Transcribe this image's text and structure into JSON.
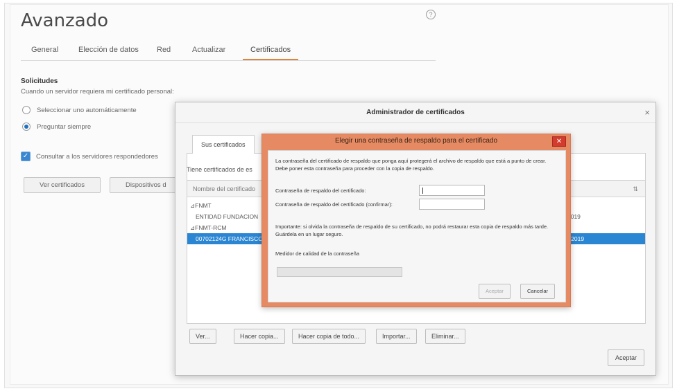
{
  "prefs": {
    "title": "Avanzado",
    "help_icon": "?",
    "tabs": [
      "General",
      "Elección de datos",
      "Red",
      "Actualizar",
      "Certificados"
    ],
    "section_title": "Solicitudes",
    "description": "Cuando un servidor requiera mi certificado personal:",
    "radio1": "Seleccionar uno automáticamente",
    "radio2": "Preguntar siempre",
    "checkbox": "Consultar a los servidores respondedores",
    "button1": "Ver certificados",
    "button2": "Dispositivos d"
  },
  "manager": {
    "title": "Administrador de certificados",
    "close": "×",
    "tab": "Sus certificados",
    "intro": "Tiene certificados de es",
    "column_name": "Nombre del certificado",
    "column_icon": "⇅",
    "rows": [
      {
        "c1": "⊿FNMT",
        "c2": ""
      },
      {
        "c1": "ENTIDAD FUNDACION",
        "c2": "2019"
      },
      {
        "c1": "⊿FNMT-RCM",
        "c2": ""
      },
      {
        "c1": "00702124G FRANCISCO",
        "c2": "- 2019"
      }
    ],
    "buttons": [
      "Ver...",
      "Hacer copia...",
      "Hacer copia de todo...",
      "Importar...",
      "Eliminar..."
    ],
    "ok": "Aceptar"
  },
  "password": {
    "title": "Elegir una contraseña de respaldo para el certificado",
    "close": "✕",
    "intro": "La contraseña del certificado de respaldo que ponga aquí protegerá el archivo de respaldo que está a punto de crear. Debe poner esta contraseña para proceder con la copia de respaldo.",
    "label1": "Contraseña de respaldo del certificado:",
    "label2": "Contraseña de respaldo del certificado (confirmar):",
    "field1_value": "",
    "field2_value": "",
    "important": "Importante: si olvida la contraseña de respaldo de su certificado, no podrá restaurar esta copia de respaldo más tarde. Guárdela en un lugar seguro.",
    "meter_label": "Medidor de calidad de la contraseña",
    "meter_level": 0,
    "accept": "Aceptar",
    "cancel": "Cancelar"
  }
}
